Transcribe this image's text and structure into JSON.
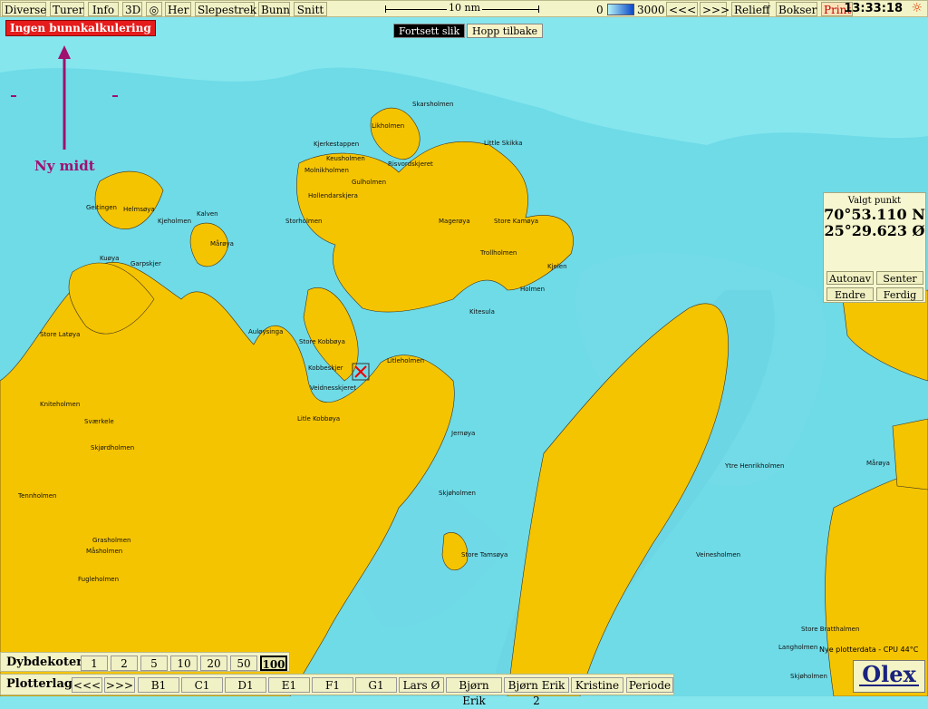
{
  "toolbar": {
    "diverse": "Diverse",
    "turer": "Turer",
    "info": "Info",
    "d3": "3D",
    "her": "Her",
    "slepestrek": "Slepestrek",
    "bunn": "Bunn",
    "snitt": "Snitt",
    "scale": "10 nm",
    "depth_min": "0",
    "depth_max": "3000",
    "prev": "<<<",
    "next": ">>>",
    "relieff": "Relieff",
    "bokser": "Bokser",
    "print": "Print",
    "clock": "13:33:18"
  },
  "alert": "Ingen bunnkalkulering",
  "search": {
    "continue": "Fortsett slik",
    "back": "Hopp tilbake"
  },
  "north_label": "Ny midt",
  "selected_point": {
    "title": "Valgt punkt",
    "lat": "70°53.110 N",
    "lon": "25°29.623 Ø",
    "autonav": "Autonav",
    "senter": "Senter",
    "endre": "Endre",
    "ferdig": "Ferdig"
  },
  "depth_contours": {
    "label": "Dybdekoter",
    "values": [
      "1",
      "2",
      "5",
      "10",
      "20",
      "50",
      "100"
    ],
    "selected": "100"
  },
  "plotter_layers": {
    "label": "Plotterlag",
    "prev": "<<<",
    "next": ">>>",
    "layers": [
      "B1",
      "C1",
      "D1",
      "E1",
      "F1",
      "G1",
      "Lars Ø",
      "Bjørn Erik",
      "Bjørn Erik 2",
      "Kristine"
    ],
    "periode": "Periode"
  },
  "status": "Nye plotterdata - CPU 44°C",
  "brand": "Olex",
  "places": [
    "Skarsholmen",
    "Likholmen",
    "Kjerkestappen",
    "Little Skikka",
    "Keusholmen",
    "Risvordskjeret",
    "Molnikholmen",
    "Gulholmen",
    "Hollendarskjera",
    "Geitingen",
    "Helmsøya",
    "Kalven",
    "Kjeholmen",
    "Storholmen",
    "Magerøya",
    "Store Kamøya",
    "Mårøya",
    "Trollholmen",
    "Kjelen",
    "Kuøya",
    "Garpskjer",
    "Holmen",
    "Auløysinga",
    "Kitesula",
    "Store Latøya",
    "Store Kobbøya",
    "Kobbeskjer",
    "Litleholmen",
    "Veidnesskjeret",
    "Kniteholmen",
    "Litle Kobbøya",
    "Sværkele",
    "Skjørdholmen",
    "Jernøya",
    "Ytre Henrikholmen",
    "Mårøya",
    "Tennholmen",
    "Skjøholmen",
    "Grasholmen",
    "Store Tamsøya",
    "Veinesholmen",
    "Måsholmen",
    "Fugleholmen",
    "Store Bratthalmen",
    "Langholmen",
    "Skjøholmen"
  ],
  "colors": {
    "land": "#f5c400",
    "shallow": "#86e6ee",
    "deep": "#5cd6e4",
    "accent": "#a0106e"
  }
}
